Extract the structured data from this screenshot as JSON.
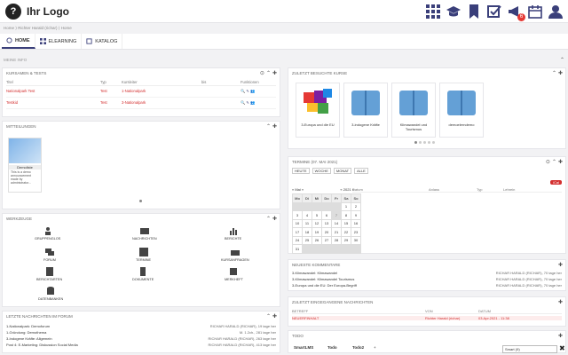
{
  "header": {
    "logo_text": "Ihr Logo",
    "logo_mark": "?",
    "notification_count": "6"
  },
  "breadcrumb": "Home ⟩ Richter Harald (richar) ⟩ Home",
  "tabs": [
    {
      "label": "HOME"
    },
    {
      "label": "ELEARNING"
    },
    {
      "label": "KATALOG"
    }
  ],
  "meine_info": "MEINE INFO",
  "kurse": {
    "title": "KURSAMEN & TESTS",
    "headers": [
      "Titel",
      "Typ",
      "Kursleiter",
      "bis",
      "Funktionen"
    ],
    "rows": [
      {
        "title": "Nationalpark Test",
        "type": "Test",
        "leader": "1-Nationalpark"
      },
      {
        "title": "Testkid",
        "type": "Test",
        "leader": "3-Nationalpark"
      }
    ]
  },
  "mitteilungen": {
    "title": "MITTEILUNGEN",
    "card_title": "Demoliste",
    "card_text": "This is a demo announcement made by administrator..."
  },
  "werkzeuge": {
    "title": "WERKZEUGE",
    "items": [
      "GRUPPENGLOS",
      "NACHRICHTEN",
      "BERICHTE",
      "FORUM",
      "TERMINE",
      "KURSANFRAGEN",
      "BERICHTARTEN",
      "DOKUMENTE",
      "MERKHEFT",
      "DATENBANKEN"
    ]
  },
  "forum": {
    "title": "LETZTE NACHRICHTEN IM FORUM",
    "rows": [
      {
        "l": "1-Nationalpark: Demoforum",
        "r": "RICHAR HARALD (RICHAR), 19 tage her"
      },
      {
        "l": "1-Gründung: Demothema",
        "r": "M. 1.2ch., 281 tage her"
      },
      {
        "l": "3-Indogene Kräfte: Allgemein",
        "r": "RICHAR HARALD (RICHAR), 263 tage her"
      },
      {
        "l": "Post 4: E-Marketing: Diskussion Social Media",
        "r": "RICHAR HARALD (RICHAR), 413 tage her"
      }
    ]
  },
  "zuletzt_kurse": {
    "title": "ZULETZT BESUCHTE KURSE",
    "items": [
      "3-Europa und die EU",
      "3-indogene Kräfte",
      "Klimawandel und Tourismus",
      "demoelerndemo"
    ]
  },
  "termine": {
    "title": "TERMINE (07. MAI 2021)",
    "views": [
      "HEUTE",
      "WOCHE",
      "MONAT",
      "ALLE"
    ],
    "month_label": "« Mai »",
    "year_label": "« 2021 »",
    "weekdays": [
      "Mo",
      "Di",
      "Mi",
      "Do",
      "Fr",
      "Sa",
      "So"
    ],
    "weeks": [
      [
        "",
        "",
        "",
        "",
        "",
        "1",
        "2"
      ],
      [
        "3",
        "4",
        "5",
        "6",
        "7",
        "8",
        "9"
      ],
      [
        "10",
        "11",
        "12",
        "13",
        "14",
        "15",
        "16"
      ],
      [
        "17",
        "18",
        "19",
        "20",
        "21",
        "22",
        "23"
      ],
      [
        "24",
        "25",
        "26",
        "27",
        "28",
        "29",
        "30"
      ],
      [
        "31",
        "",
        "",
        "",
        "",
        "",
        ""
      ]
    ],
    "columns": [
      "Datum",
      "Anlass",
      "Typ",
      "Lehrein"
    ],
    "ical": "iCal"
  },
  "kommentare": {
    "title": "NEUESTE KOMMENTARE",
    "rows": [
      {
        "l": "3-Klimawandel: Klimawandel",
        "r": "RICHAR HARALD (RICHAR), 70 tage her"
      },
      {
        "l": "3-Klimawandel: Klimawandel Tourismus",
        "r": "RICHAR HARALD (RICHAR), 70 tage her"
      },
      {
        "l": "3-Europa und die EU: Der Europa-Begriff",
        "r": "RICHAR HARALD (RICHAR), 70 tage her"
      }
    ]
  },
  "nachrichten": {
    "title": "ZULETZT EINGEGANGENE NACHRICHTEN",
    "headers": [
      "BETREFF",
      "VON",
      "DATUM"
    ],
    "row": {
      "subject": "NEUERFINHALT",
      "from": "Richter Harald (richar)",
      "date": "03.Apr.2021 - 11:38"
    }
  },
  "todo": {
    "title": "TODO",
    "tabs": [
      "SmartLMS",
      "Todo",
      "Todo2"
    ],
    "search_placeholder": "Smart (9)"
  },
  "colors": {
    "accent": "#3a3f7a",
    "danger": "#d32f2f"
  }
}
